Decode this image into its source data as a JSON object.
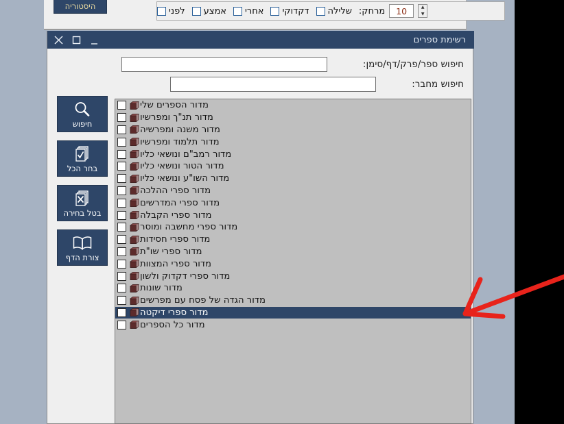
{
  "colors": {
    "desktop": "#a6b2c2",
    "accent_navy": "#2e4668",
    "list_bg": "#bfbfbf",
    "panel_bg": "#efefef",
    "history_text": "#e8d9a0",
    "annotation_red": "#e8231b",
    "book_icon": "#5c2b2b"
  },
  "toolbar": {
    "history_label": "היסטוריה",
    "checkboxes": [
      {
        "label": "לפני",
        "checked": false
      },
      {
        "label": "אמצע",
        "checked": false
      },
      {
        "label": "אחרי",
        "checked": false
      },
      {
        "label": "דקדוקי",
        "checked": false
      },
      {
        "label": "שלילה",
        "checked": false
      }
    ],
    "distance_label": "מרחק:",
    "distance_value": "10"
  },
  "dialog": {
    "title": "רשימת ספרים",
    "window_buttons": {
      "close": "✕",
      "maximize": "▢",
      "minimize": "_"
    },
    "search": {
      "book_label": "חיפוש ספר/פרק/דף/סימן:",
      "book_value": "",
      "book_placeholder": "",
      "author_label": "חיפוש מחבר:",
      "author_value": "",
      "author_placeholder": ""
    },
    "side_buttons": [
      {
        "label": "חיפוש",
        "icon": "magnifier-icon"
      },
      {
        "label": "בחר הכל",
        "icon": "checked-pages-icon"
      },
      {
        "label": "בטל בחירה",
        "icon": "x-pages-icon"
      },
      {
        "label": "צורת הדף",
        "icon": "open-book-icon"
      }
    ],
    "list": {
      "items": [
        {
          "label": "מדור הספרים שלי",
          "checked": false,
          "selected": false
        },
        {
          "label": "מדור תנ\"ך ומפרשיו",
          "checked": false,
          "selected": false
        },
        {
          "label": "מדור משנה ומפרשיה",
          "checked": false,
          "selected": false
        },
        {
          "label": "מדור תלמוד ומפרשיו",
          "checked": false,
          "selected": false
        },
        {
          "label": "מדור רמב\"ם ונושאי כליו",
          "checked": false,
          "selected": false
        },
        {
          "label": "מדור הטור ונושאי כליו",
          "checked": false,
          "selected": false
        },
        {
          "label": "מדור השו\"ע ונושאי כליו",
          "checked": false,
          "selected": false
        },
        {
          "label": "מדור ספרי ההלכה",
          "checked": false,
          "selected": false
        },
        {
          "label": "מדור ספרי המדרשים",
          "checked": false,
          "selected": false
        },
        {
          "label": "מדור ספרי הקבלה",
          "checked": false,
          "selected": false
        },
        {
          "label": "מדור ספרי מחשבה ומוסר",
          "checked": false,
          "selected": false
        },
        {
          "label": "מדור ספרי חסידות",
          "checked": false,
          "selected": false
        },
        {
          "label": "מדור ספרי שו\"ת",
          "checked": false,
          "selected": false
        },
        {
          "label": "מדור ספרי המצוות",
          "checked": false,
          "selected": false
        },
        {
          "label": "מדור ספרי דקדוק ולשון",
          "checked": false,
          "selected": false
        },
        {
          "label": "מדור שונות",
          "checked": false,
          "selected": false
        },
        {
          "label": "מדור הגדה של פסח עם מפרשים",
          "checked": false,
          "selected": false
        },
        {
          "label": "מדור ספרי דיקטה",
          "checked": false,
          "selected": true
        },
        {
          "label": "מדור כל הספרים",
          "checked": false,
          "selected": false
        }
      ]
    }
  },
  "annotation": {
    "type": "red-arrow",
    "points_to": "מדור ספרי דיקטה"
  }
}
